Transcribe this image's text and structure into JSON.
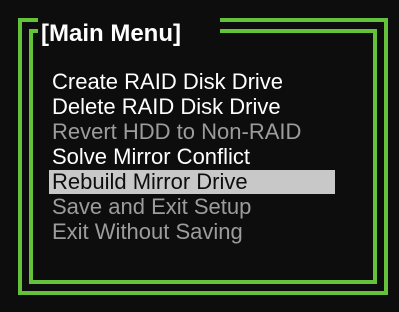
{
  "menu": {
    "title": "[Main Menu]",
    "items": [
      {
        "label": "Create RAID Disk Drive",
        "state": "enabled"
      },
      {
        "label": "Delete RAID Disk Drive",
        "state": "enabled"
      },
      {
        "label": "Revert HDD to Non-RAID",
        "state": "disabled"
      },
      {
        "label": "Solve Mirror Conflict",
        "state": "enabled"
      },
      {
        "label": "Rebuild Mirror Drive",
        "state": "selected"
      },
      {
        "label": "Save and Exit Setup",
        "state": "disabled"
      },
      {
        "label": "Exit Without Saving",
        "state": "disabled"
      }
    ],
    "colors": {
      "background": "#0d0d0d",
      "frame": "#63c23a",
      "enabled_text": "#ffffff",
      "disabled_text": "#9c9c9c",
      "highlight": "#c8c8c8"
    }
  }
}
